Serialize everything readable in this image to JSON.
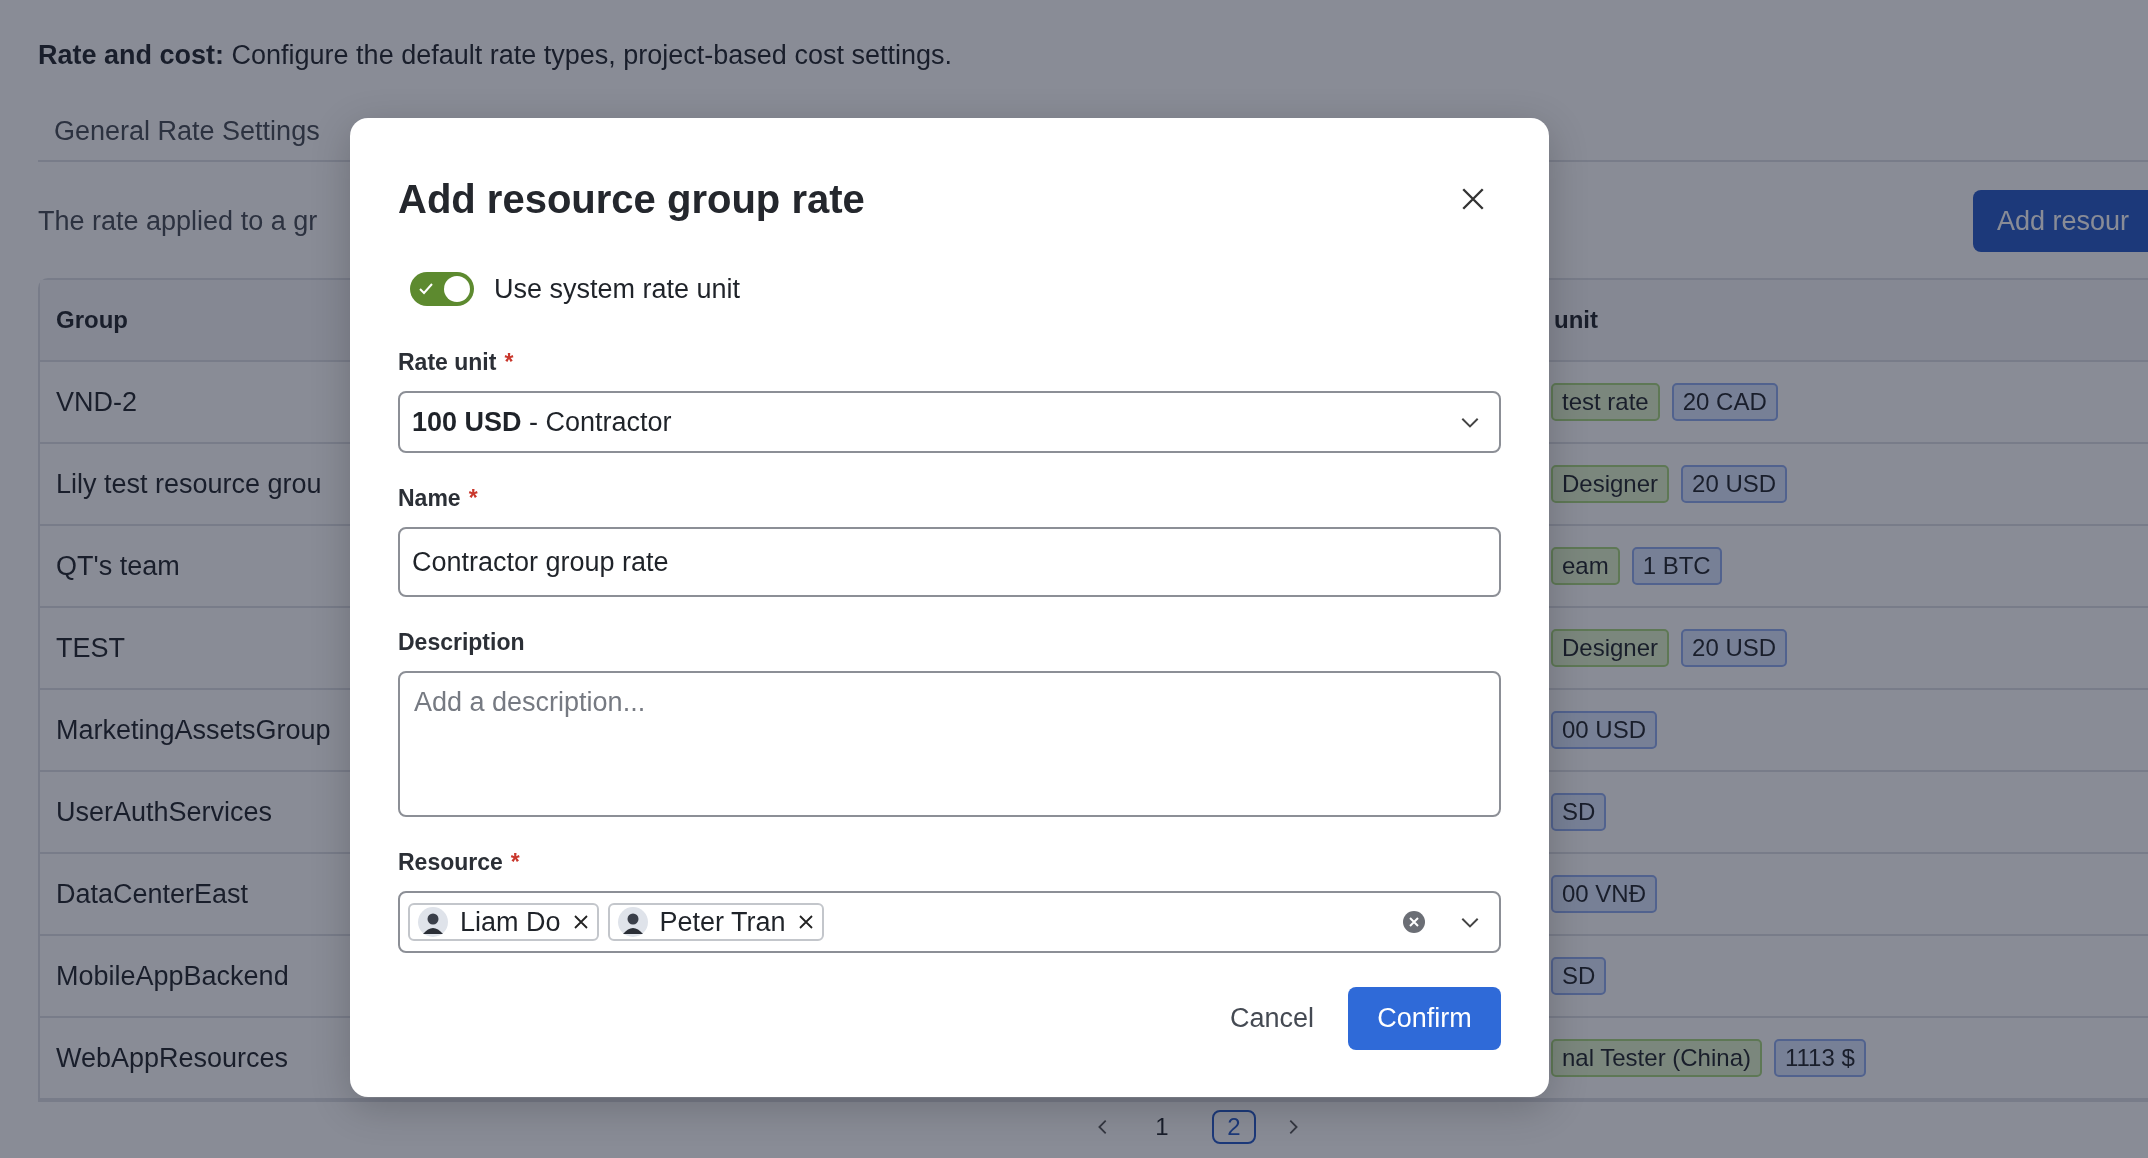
{
  "page": {
    "intro": "**Rate and cost:** Configure the default rate types, project-based cost settings.",
    "tab": "General Rate Settings",
    "description": "The rate applied to a gr",
    "add_button": "Add resour",
    "table": {
      "columns": [
        "Group",
        "unit"
      ],
      "rows": [
        {
          "group": "VND-2",
          "tags": [
            {
              "text": "test rate",
              "kind": "role"
            },
            {
              "text": "20 CAD",
              "kind": "rate"
            }
          ]
        },
        {
          "group": "Lily test resource grou",
          "tags": [
            {
              "text": "Designer",
              "kind": "role"
            },
            {
              "text": "20 USD",
              "kind": "rate"
            }
          ]
        },
        {
          "group": "QT's team",
          "tags": [
            {
              "text": "eam",
              "kind": "role"
            },
            {
              "text": "1 BTC",
              "kind": "rate"
            }
          ]
        },
        {
          "group": "TEST",
          "tags": [
            {
              "text": "Designer",
              "kind": "role"
            },
            {
              "text": "20 USD",
              "kind": "rate"
            }
          ]
        },
        {
          "group": "MarketingAssetsGroup",
          "tags": [
            {
              "text": "00 USD",
              "kind": "rate"
            }
          ]
        },
        {
          "group": "UserAuthServices",
          "tags": [
            {
              "text": "SD",
              "kind": "rate"
            }
          ]
        },
        {
          "group": "DataCenterEast",
          "tags": [
            {
              "text": "00 VNĐ",
              "kind": "rate"
            }
          ]
        },
        {
          "group": "MobileAppBackend",
          "tags": [
            {
              "text": "SD",
              "kind": "rate"
            }
          ]
        },
        {
          "group": "WebAppResources",
          "tags": [
            {
              "text": "nal Tester (China)",
              "kind": "role"
            },
            {
              "text": "1113 $",
              "kind": "rate"
            }
          ]
        }
      ]
    },
    "pagination": [
      {
        "label": "1",
        "selected": false
      },
      {
        "label": "2",
        "selected": true
      }
    ]
  },
  "dialog": {
    "title": "Add resource group rate",
    "toggle": {
      "label": "Use system rate unit",
      "on": true
    },
    "fields": [
      {
        "kind": "select",
        "label": "Rate unit",
        "mark": "*",
        "value": "**100 USD**  - Contractor"
      },
      {
        "kind": "input",
        "label": "Name",
        "mark": "*",
        "value": "Contractor group rate"
      },
      {
        "kind": "textarea",
        "label": "Description",
        "placeholder": "Add a description..."
      },
      {
        "kind": "multiselect",
        "label": "Resource",
        "mark": "*",
        "chips": [
          "Liam Do",
          "Peter Tran"
        ]
      }
    ],
    "cancel": "Cancel",
    "confirm": "Confirm"
  }
}
